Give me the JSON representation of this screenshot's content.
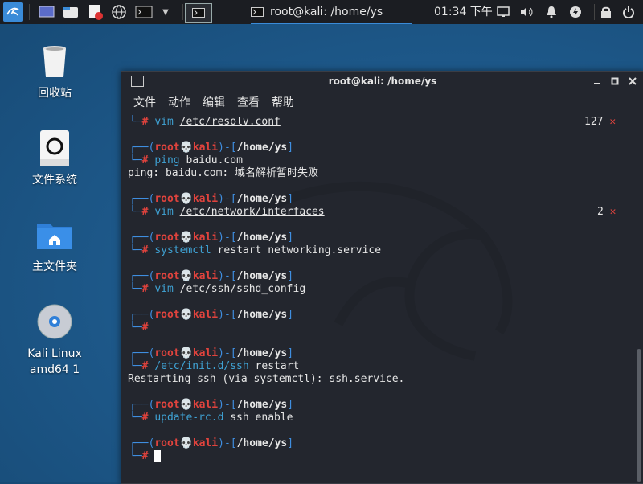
{
  "panel": {
    "window_title": "root@kali: /home/ys",
    "clock": "01:34 下午"
  },
  "desktop": {
    "icons": [
      {
        "label": "回收站"
      },
      {
        "label": "文件系统"
      },
      {
        "label": "主文件夹"
      },
      {
        "label": "Kali Linux\namd64 1"
      }
    ]
  },
  "terminal": {
    "title": "root@kali: /home/ys",
    "menu": [
      "文件",
      "动作",
      "编辑",
      "查看",
      "帮助"
    ],
    "prompt_user": "root",
    "prompt_skull": "💀",
    "prompt_host": "kali",
    "prompt_path": "/home/ys",
    "prompt_hash": "#",
    "lines": [
      {
        "cmd": "vim",
        "arg": "/etc/resolv.conf",
        "status": "127"
      },
      {
        "cmd": "ping",
        "arg": "baidu.com",
        "output": "ping: baidu.com: 域名解析暂时失败"
      },
      {
        "cmd": "vim",
        "arg": "/etc/network/interfaces",
        "status": "2"
      },
      {
        "cmd": "systemctl",
        "arg": "restart networking.service"
      },
      {
        "cmd": "vim",
        "arg": "/etc/ssh/sshd_config"
      },
      {
        "cmd": "",
        "arg": ""
      },
      {
        "cmd": "/etc/init.d/ssh",
        "arg": "restart",
        "output": "Restarting ssh (via systemctl): ssh.service."
      },
      {
        "cmd": "update-rc.d",
        "arg": "ssh enable"
      },
      {
        "cmd": "",
        "arg": ""
      }
    ],
    "status_mark": "✕"
  }
}
